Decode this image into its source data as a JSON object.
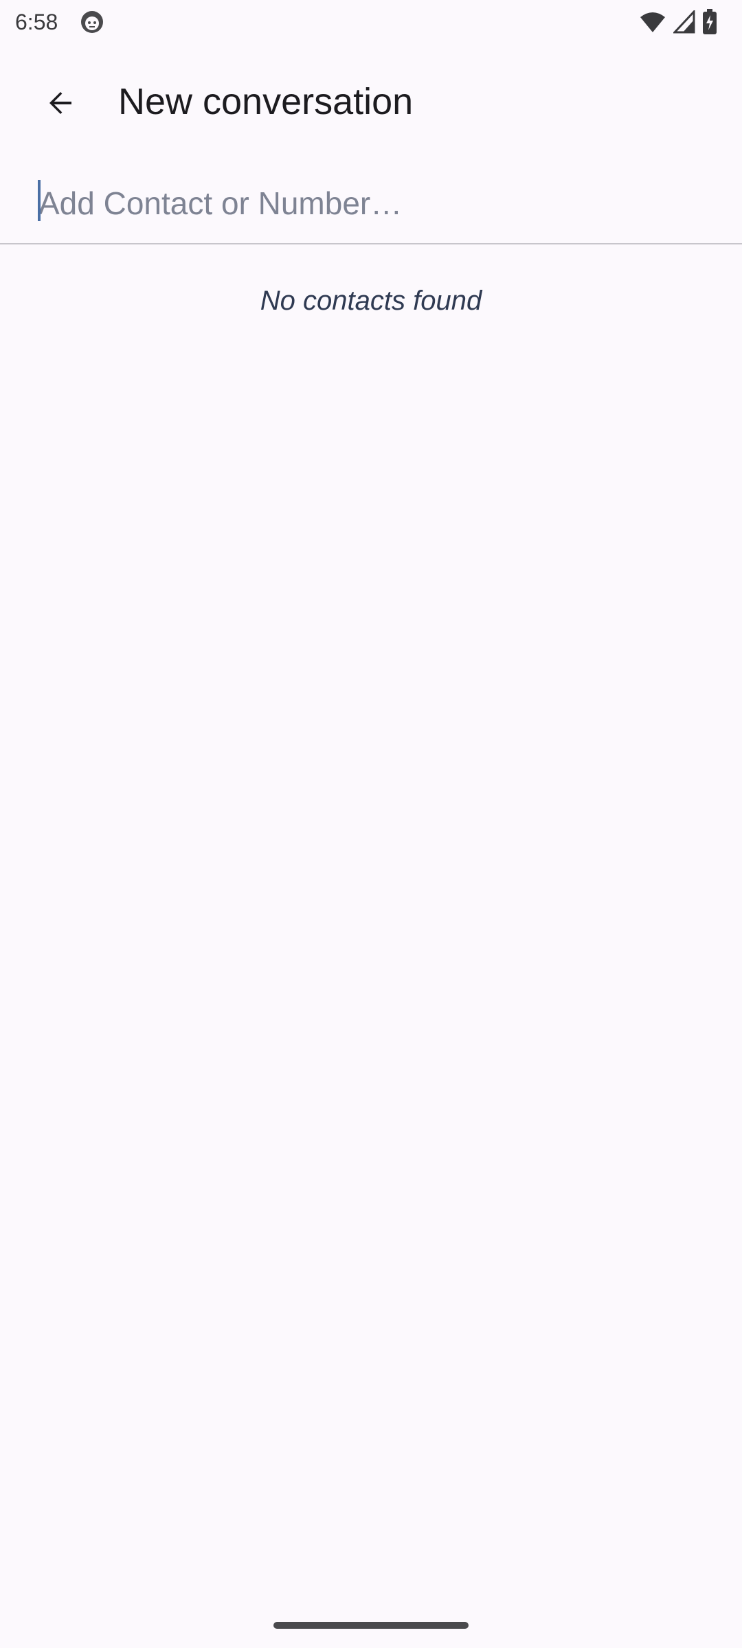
{
  "status_bar": {
    "time": "6:58",
    "icons": [
      "app-notification-icon",
      "wifi-icon",
      "cellular-signal-icon",
      "battery-charging-icon"
    ]
  },
  "app_bar": {
    "back_icon": "arrow-back-icon",
    "title": "New conversation"
  },
  "recipient": {
    "value": "",
    "placeholder": "Add Contact or Number…"
  },
  "contacts": {
    "empty_message": "No contacts found"
  },
  "colors": {
    "background": "#fcf9fd",
    "accent": "#4a6fa5",
    "empty_text": "#2f3a52"
  }
}
